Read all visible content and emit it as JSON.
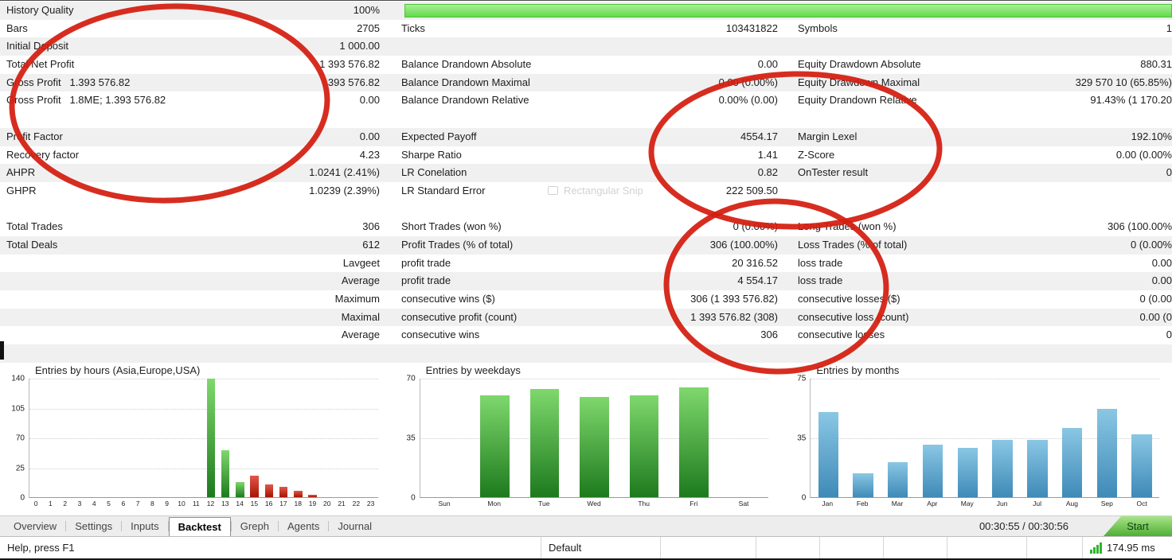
{
  "stats": {
    "rows": [
      {
        "l1": "History Quality",
        "v1": "100%",
        "progress": true
      },
      {
        "l1": "Bars",
        "v1": "2705",
        "l2": "Ticks",
        "v2": "103431822",
        "l3": "Symbols",
        "v3": "1"
      },
      {
        "l1": "Initial Deposit",
        "v1": "1 000.00"
      },
      {
        "l1": "Total Net Profit",
        "v1": "1 393 576.82",
        "l2": "Balance Drandown Absolute",
        "v2": "0.00",
        "l3": "Equity Drawdown Absolute",
        "v3": "880.31"
      },
      {
        "l1": "Gross Profit   1.393 576.82",
        "v1": "393 576.82",
        "l2": "Balance Drandown Maximal",
        "v2": "0.00 (0.00%)",
        "l3": "Equity Drawdown Maximal",
        "v3": "329 570 10 (65.85%)"
      },
      {
        "l1": "Gross Profit   1.8ME; 1.393 576.82",
        "v1": "0.00",
        "l2": "Balance Drandown Relative",
        "v2": "0.00% (0.00)",
        "l3": "Equity Drandown Relative",
        "v3": "91.43% (1 170.20"
      },
      {},
      {
        "l1": "Profit Factor",
        "v1": "0.00",
        "l2": "Expected Payoff",
        "v2": "4554.17",
        "l3": "Margin Lexel",
        "v3": "192.10%"
      },
      {
        "l1": "Recovery factor",
        "v1": "4.23",
        "l2": "Sharpe Ratio",
        "v2": "1.41",
        "l3": "Z-Score",
        "v3": "0.00 (0.00%"
      },
      {
        "l1": "AHPR",
        "v1": "1.0241 (2.41%)",
        "l2": "LR Conelation",
        "v2": "0.82",
        "l3": "OnTester result",
        "v3": "0"
      },
      {
        "l1": "GHPR",
        "v1": "1.0239 (2.39%)",
        "l2": "LR Standard Error",
        "v2": "222 509.50"
      },
      {},
      {
        "l1": "Total Trades",
        "v1": "306",
        "l2": "Short Trades (won %)",
        "v2": "0 (0.00%)",
        "l3": "Long Trades (won %)",
        "v3": "306 (100.00%"
      },
      {
        "l1": "Total Deals",
        "v1": "612",
        "l2": "Profit Trades (% of total)",
        "v2": "306 (100.00%)",
        "l3": "Loss Trades (% of total)",
        "v3": "0 (0.00%"
      },
      {
        "v1": "Lavgeet",
        "l2": "profit trade",
        "v2": "20 316.52",
        "l3": "loss trade",
        "v3": "0.00"
      },
      {
        "v1": "Average",
        "l2": "profit trade",
        "v2": "4 554.17",
        "l3": "loss trade",
        "v3": "0.00"
      },
      {
        "v1": "Maximum",
        "l2": "consecutive wins ($)",
        "v2": "306 (1 393 576.82)",
        "l3": "consecutive losses ($)",
        "v3": "0 (0.00"
      },
      {
        "v1": "Maximal",
        "l2": "consecutive profit (count)",
        "v2": "1 393 576.82 (308)",
        "l3": "consecutive loss (count)",
        "v3": "0.00 (0"
      },
      {
        "v1": "Average",
        "l2": "consecutive wins",
        "v2": "306",
        "l3": "consecutive losses",
        "v3": "0"
      },
      {}
    ]
  },
  "chart_data": [
    {
      "type": "bar",
      "title": "Entries by hours (Asia,Europe,USA)",
      "categories": [
        "0",
        "1",
        "2",
        "3",
        "4",
        "5",
        "6",
        "7",
        "8",
        "9",
        "10",
        "11",
        "12",
        "13",
        "14",
        "15",
        "16",
        "17",
        "18",
        "19",
        "20",
        "21",
        "22",
        "23"
      ],
      "values": [
        0,
        0,
        0,
        0,
        0,
        0,
        0,
        0,
        0,
        0,
        0,
        0,
        140,
        55,
        18,
        25,
        15,
        12,
        8,
        3,
        0,
        0,
        0,
        0
      ],
      "colors": [
        null,
        null,
        null,
        null,
        null,
        null,
        null,
        null,
        null,
        null,
        null,
        null,
        "green",
        "green",
        "green",
        "red",
        "red",
        "red",
        "red",
        "red",
        null,
        null,
        null,
        null
      ],
      "yticks": [
        "140",
        "105",
        "70",
        "25",
        "0"
      ],
      "ylim": [
        0,
        140
      ],
      "xlabel": "",
      "ylabel": "",
      "grid": true,
      "legend": "none"
    },
    {
      "type": "bar",
      "title": "Entries by weekdays",
      "categories": [
        "Sun",
        "Mon",
        "Tue",
        "Wed",
        "Thu",
        "Fri",
        "Sat"
      ],
      "values": [
        0,
        60,
        64,
        59,
        60,
        65,
        0
      ],
      "bar_color": "green",
      "yticks": [
        "70",
        "35",
        "0"
      ],
      "ylim": [
        0,
        70
      ],
      "xlabel": "",
      "ylabel": "",
      "grid": true,
      "legend": "none"
    },
    {
      "type": "bar",
      "title": "Entries by months",
      "categories": [
        "Jan",
        "Feb",
        "Mar",
        "Apr",
        "May",
        "Jun",
        "Jul",
        "Aug",
        "Sep",
        "Oct"
      ],
      "values": [
        54,
        15,
        22,
        33,
        31,
        36,
        36,
        44,
        56,
        40
      ],
      "bar_color": "blue",
      "yticks": [
        "75",
        "35",
        "0"
      ],
      "ylim": [
        0,
        75
      ],
      "xlabel": "",
      "ylabel": "",
      "grid": true,
      "legend": "none"
    }
  ],
  "tabbar": {
    "tabs": [
      "Overview",
      "Settings",
      "Inputs",
      "Backtest",
      "Greph",
      "Agents",
      "Journal"
    ],
    "active": "Backtest",
    "timer": "00:30:55 / 00:30:56",
    "start_label": "Start"
  },
  "statusbar": {
    "help": "Help, press F1",
    "profile": "Default",
    "latency": "174.95 ms"
  },
  "annotations": {
    "watermark": "Rectangular Snip",
    "circle_color": "#d41d0f"
  },
  "colors": {
    "progress_green": "#74e85e",
    "bar_green": "#2d8a2d",
    "bar_red": "#bb2a10",
    "bar_blue": "#4f95c0",
    "annotation_red": "#d41d0f",
    "start_button_green": "#5cb53e"
  }
}
